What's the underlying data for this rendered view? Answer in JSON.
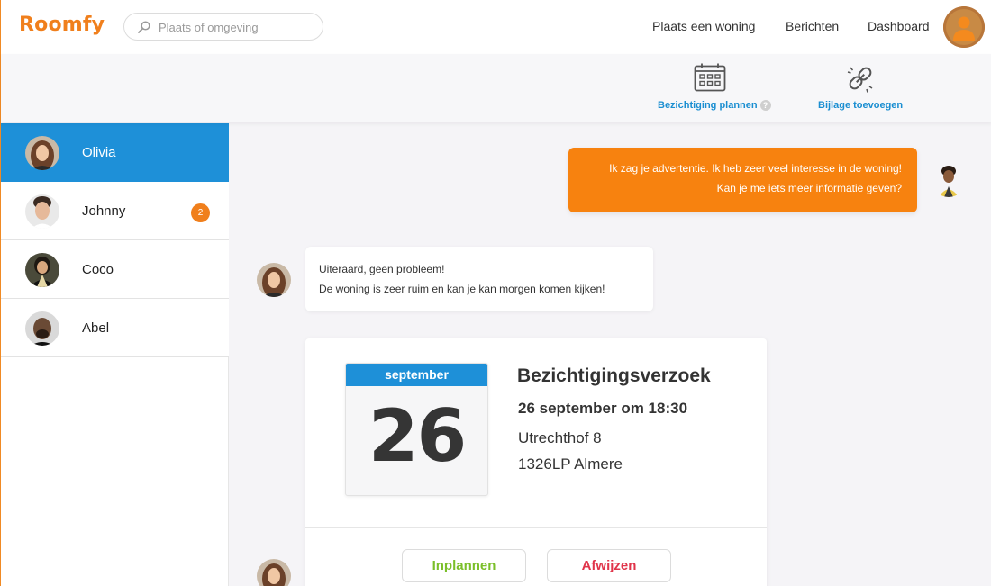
{
  "app": {
    "logo": "Roomfy"
  },
  "search": {
    "placeholder": "Plaats of omgeving",
    "value": ""
  },
  "nav": {
    "links": [
      "Plaats een woning",
      "Berichten",
      "Dashboard"
    ]
  },
  "toolbar": {
    "schedule_label": "Bezichtiging plannen",
    "help_glyph": "?",
    "attach_label": "Bijlage toevoegen"
  },
  "contacts": [
    {
      "name": "Olivia",
      "active": true,
      "badge": ""
    },
    {
      "name": "Johnny",
      "active": false,
      "badge": "2"
    },
    {
      "name": "Coco",
      "active": false,
      "badge": ""
    },
    {
      "name": "Abel",
      "active": false,
      "badge": ""
    }
  ],
  "chat": {
    "outgoing": {
      "line1": "Ik zag je advertentie. Ik heb zeer veel interesse in de woning!",
      "line2": "Kan je me iets meer informatie geven?"
    },
    "incoming": {
      "line1": "Uiteraard, geen probleem!",
      "line2": "De woning is zeer ruim en kan je kan morgen komen kijken!"
    },
    "request": {
      "month": "september",
      "day": "26",
      "title": "Bezichtigingsverzoek",
      "when": "26 september om 18:30",
      "street": "Utrechthof 8",
      "city": "1326LP Almere",
      "accept_label": "Inplannen",
      "decline_label": "Afwijzen"
    }
  },
  "colors": {
    "brand_orange": "#f07f1c",
    "accent_blue": "#1e90d8",
    "accept_green": "#7bbf2a",
    "decline_red": "#e0344a"
  }
}
